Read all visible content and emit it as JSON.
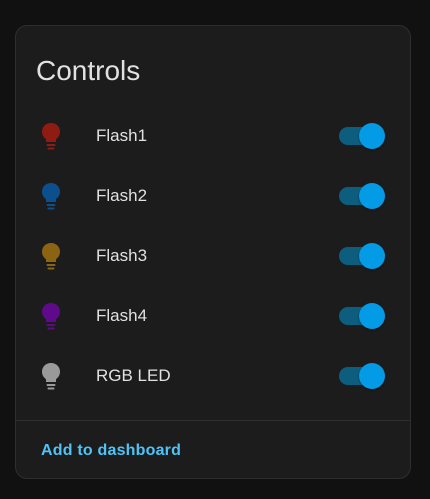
{
  "card": {
    "title": "Controls",
    "footer_link": "Add to dashboard"
  },
  "colors": {
    "toggle_on": "#039be5",
    "toggle_track_on": "#0d5e7e",
    "link": "#4fc3f7"
  },
  "rows": [
    {
      "label": "Flash1",
      "icon": "lightbulb-icon",
      "icon_color": "#8e1c12",
      "on": true
    },
    {
      "label": "Flash2",
      "icon": "lightbulb-icon",
      "icon_color": "#0d4e8c",
      "on": true
    },
    {
      "label": "Flash3",
      "icon": "lightbulb-icon",
      "icon_color": "#8a6412",
      "on": true
    },
    {
      "label": "Flash4",
      "icon": "lightbulb-icon",
      "icon_color": "#5e0a8a",
      "on": true
    },
    {
      "label": "RGB LED",
      "icon": "lightbulb-icon",
      "icon_color": "#9a9a9a",
      "on": true
    }
  ]
}
